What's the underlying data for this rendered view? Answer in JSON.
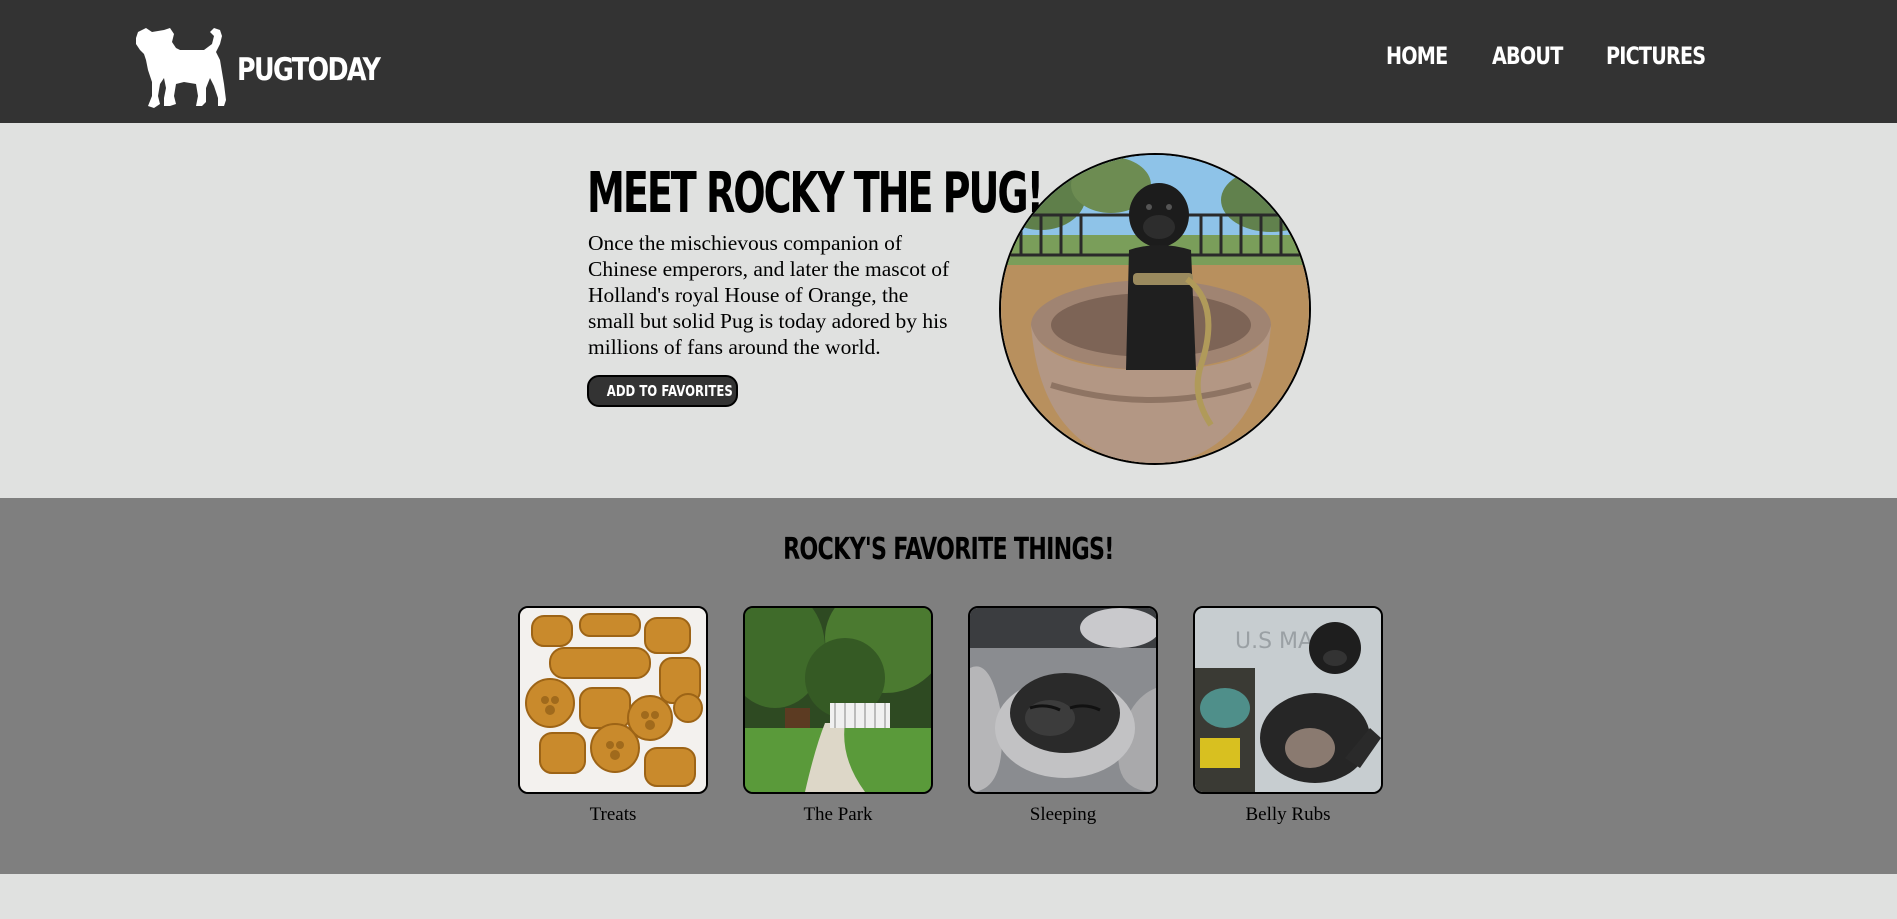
{
  "header": {
    "brand": "PUGTODAY",
    "logo_icon": "pug-silhouette-icon",
    "nav": [
      {
        "label": "HOME"
      },
      {
        "label": "ABOUT"
      },
      {
        "label": "PICTURES"
      }
    ]
  },
  "hero": {
    "title": "MEET ROCKY THE PUG!",
    "description": "Once the mischievous companion of Chinese emperors, and later the mascot of Holland's royal House of Orange, the small but solid Pug is today adored by his millions of fans around the world.",
    "button_label": "ADD TO FAVORITES",
    "photo": "pug-in-planter-photo"
  },
  "favorites": {
    "title": "ROCKY'S FAVORITE THINGS!",
    "items": [
      {
        "label": "Treats",
        "photo": "dog-biscuits-photo"
      },
      {
        "label": "The Park",
        "photo": "park-path-photo"
      },
      {
        "label": "Sleeping",
        "photo": "sleeping-pug-photo"
      },
      {
        "label": "Belly Rubs",
        "photo": "pug-on-back-photo"
      }
    ]
  },
  "colors": {
    "header_bg": "#333333",
    "hero_bg": "#e0e1e0",
    "favorites_bg": "#7f7f7f",
    "button_bg": "#333333"
  }
}
